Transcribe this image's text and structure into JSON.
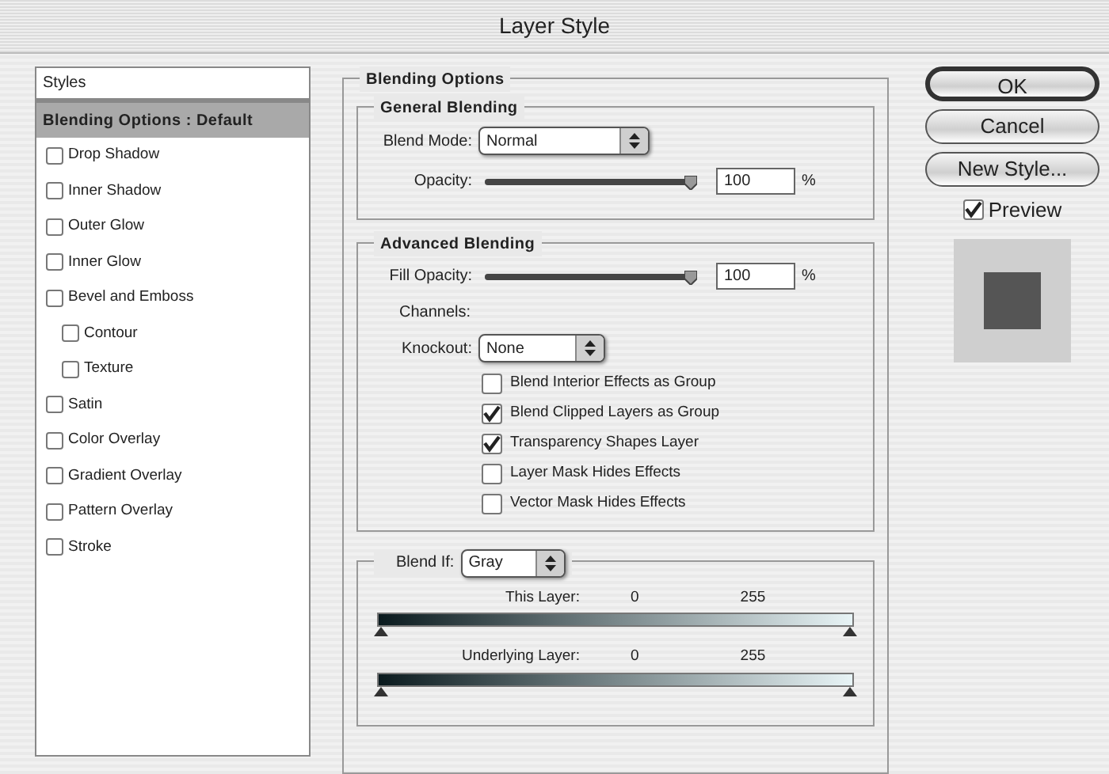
{
  "window": {
    "title": "Layer Style"
  },
  "sidebar": {
    "header": "Styles",
    "items": [
      {
        "label": "Blending Options : Default",
        "kind": "header",
        "selected": true
      },
      {
        "label": "Drop Shadow",
        "kind": "check",
        "checked": false,
        "selected": false
      },
      {
        "label": "Inner Shadow",
        "kind": "check",
        "checked": false,
        "selected": false
      },
      {
        "label": "Outer Glow",
        "kind": "check",
        "checked": false,
        "selected": false
      },
      {
        "label": "Inner Glow",
        "kind": "check",
        "checked": false,
        "selected": false
      },
      {
        "label": "Bevel and Emboss",
        "kind": "check",
        "checked": false,
        "selected": false,
        "children": [
          {
            "label": "Contour",
            "kind": "check",
            "checked": false,
            "selected": false
          },
          {
            "label": "Texture",
            "kind": "check",
            "checked": false,
            "selected": false
          }
        ]
      },
      {
        "label": "Satin",
        "kind": "check",
        "checked": false,
        "selected": false
      },
      {
        "label": "Color Overlay",
        "kind": "check",
        "checked": false,
        "selected": false
      },
      {
        "label": "Gradient Overlay",
        "kind": "check",
        "checked": false,
        "selected": false
      },
      {
        "label": "Pattern Overlay",
        "kind": "check",
        "checked": false,
        "selected": false
      },
      {
        "label": "Stroke",
        "kind": "check",
        "checked": false,
        "selected": false
      }
    ]
  },
  "blending_options": {
    "title": "Blending Options",
    "general": {
      "title": "General Blending",
      "blend_mode": {
        "label": "Blend Mode:",
        "value": "Normal"
      },
      "opacity": {
        "label": "Opacity:",
        "level": 1,
        "value": "100",
        "unit": "%"
      }
    },
    "advanced": {
      "title": "Advanced Blending",
      "fill_opacity": {
        "label": "Fill Opacity:",
        "level": 1,
        "value": "100",
        "unit": "%"
      },
      "channels_label": "Channels:",
      "knockout": {
        "label": "Knockout:",
        "value": "None"
      },
      "options": [
        {
          "label": "Blend Interior Effects as Group",
          "checked": false
        },
        {
          "label": "Blend Clipped Layers as Group",
          "checked": true
        },
        {
          "label": "Transparency Shapes Layer",
          "checked": true
        },
        {
          "label": "Layer Mask Hides Effects",
          "checked": false
        },
        {
          "label": "Vector Mask Hides Effects",
          "checked": false
        }
      ]
    },
    "blend_if": {
      "label": "Blend If:",
      "value": "Gray",
      "ramps": [
        {
          "label": "This Layer:",
          "low": "0",
          "high": "255"
        },
        {
          "label": "Underlying Layer:",
          "low": "0",
          "high": "255"
        }
      ]
    }
  },
  "buttons": [
    {
      "label": "OK",
      "default": true
    },
    {
      "label": "Cancel",
      "default": false
    },
    {
      "label": "New Style...",
      "default": false
    }
  ],
  "preview": {
    "label": "Preview",
    "checked": true
  }
}
